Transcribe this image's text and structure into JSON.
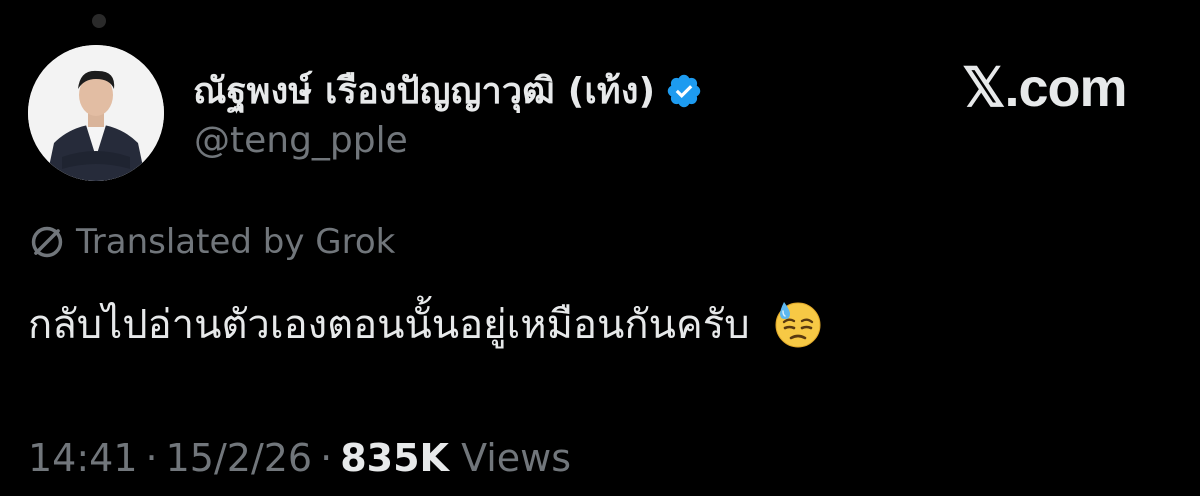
{
  "author": {
    "display_name": "ณัฐพงษ์ เรืองปัญญาวุฒิ (เท้ง)",
    "handle": "@teng_pple",
    "verified": true,
    "verified_badge_color": "#1d9bf0"
  },
  "brand": {
    "label": "𝕏.com"
  },
  "translation": {
    "label": "Translated by Grok",
    "icon": "translate-slash-icon"
  },
  "tweet": {
    "text": "กลับไปอ่านตัวเองตอนนั้นอยู่เหมือนกันครับ",
    "emoji": "downcast-face-with-sweat-emoji"
  },
  "meta": {
    "time": "14:41",
    "date": "15/2/26",
    "views_count": "835K",
    "views_label": "Views",
    "separator": "·"
  },
  "colors": {
    "background": "#000000",
    "primary_text": "#e7e9ea",
    "secondary_text": "#71767b"
  }
}
